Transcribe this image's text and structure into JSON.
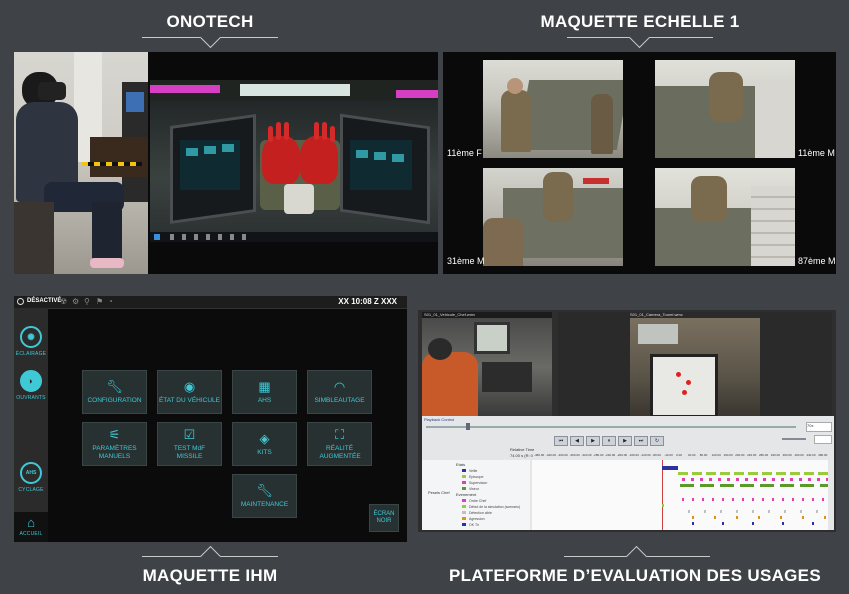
{
  "sections": {
    "onotech": "ONOTECH",
    "maquette_echelle": "MAQUETTE ECHELLE 1",
    "maquette_ihm": "MAQUETTE IHM",
    "plateforme": "PLATEFORME D’EVALUATION DES USAGES"
  },
  "scale_mockup": {
    "captions": [
      "11ème F",
      "11ème M",
      "31ème M",
      "87ème M"
    ]
  },
  "hmi": {
    "status_label": "DÉSACTIVÉ",
    "clock": "XX 10:08 Z XXX",
    "side_menu": [
      {
        "label": "ÉCLAIRAGE",
        "icon": "sun-icon"
      },
      {
        "label": "OUVRANTS",
        "icon": "hatch-icon"
      },
      {
        "label": "CYCLAGE",
        "icon": "ahs-icon",
        "badge": "AHS"
      },
      {
        "label": "ACCUEIL",
        "icon": "home-icon"
      }
    ],
    "tiles": [
      {
        "label": "CONFIGURATION",
        "icon": "wrench-icon"
      },
      {
        "label": "ÉTAT DU VÉHICULE",
        "icon": "eye-icon"
      },
      {
        "label": "AHS",
        "icon": "ahs-icon"
      },
      {
        "label": "SIMBLEAUTAGE",
        "icon": "gauge-icon"
      },
      {
        "label": "PARAMÈTRES MANUELS",
        "icon": "sliders-icon"
      },
      {
        "label": "TEST MdF MISSILE",
        "icon": "checkbox-icon"
      },
      {
        "label": "KITS",
        "icon": "kit-icon"
      },
      {
        "label": "RÉALITÉ AUGMENTÉE",
        "icon": "ar-icon"
      },
      {
        "label": "MAINTENANCE",
        "icon": "wrench-icon"
      }
    ],
    "ecran_noir": "ÉCRAN NOIR"
  },
  "usage_platform": {
    "video_left_title": "S01_01_Vehicule_Chef.wmv",
    "video_right_title": "S01_01_Camera_Tourel.wmv",
    "panel_title": "Playback Control",
    "relative_time_label": "Relative Time",
    "relative_time_value": "74.00 s (R: 0",
    "row_group": "Pesels Chef",
    "event_group_1": "Etats",
    "events_1": [
      "Veille",
      "Episcope",
      "Supervision",
      "Viseur"
    ],
    "event_group_2": "Evenement",
    "events_2": [
      "Ordre Chef",
      "Début de la simulation (scenario)",
      "Détection cible",
      "Agression",
      "OK Tir"
    ],
    "ticks": [
      "-480.00",
      "-440.00",
      "-400.00",
      "-360.00",
      "-320.00",
      "-280.00",
      "-240.00",
      "-200.00",
      "-160.00",
      "-120.00",
      "-80.00",
      "-40.00",
      "0.00",
      "40.00",
      "80.00",
      "120.00",
      "160.00",
      "200.00",
      "240.00",
      "280.00",
      "320.00",
      "360.00",
      "400.00",
      "440.00",
      "480.00"
    ],
    "zoom_value": "70x"
  },
  "colors": {
    "background": "#3f4246",
    "hmi_accent": "#3fc9d6",
    "track_green": "#9acb3c",
    "track_magenta": "#e040b0",
    "track_blue": "#3030a0"
  }
}
